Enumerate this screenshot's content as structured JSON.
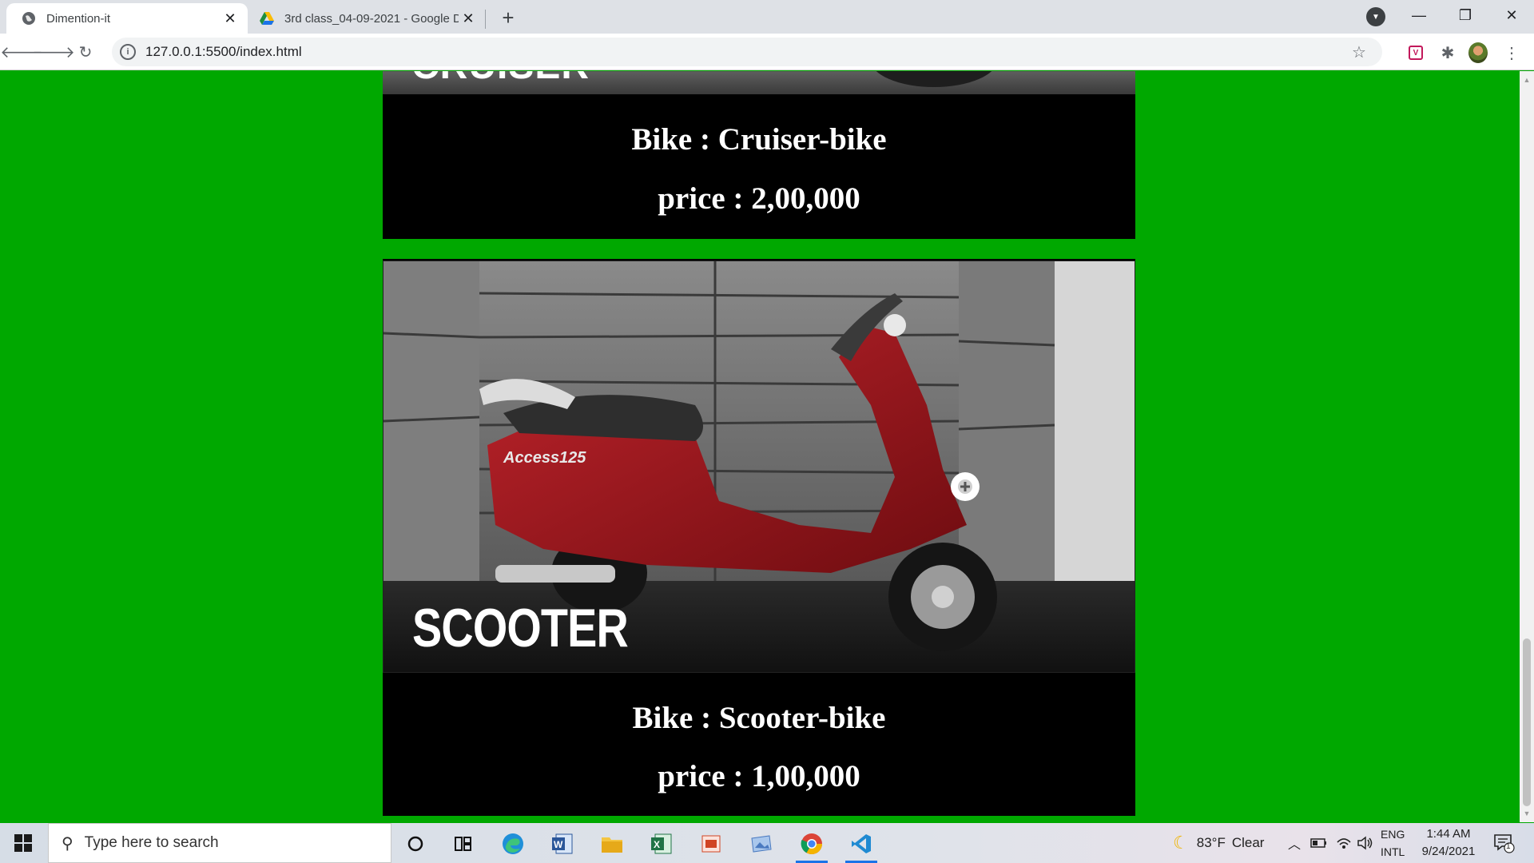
{
  "browser": {
    "tabs": [
      {
        "title": "Dimention-it",
        "active": true,
        "icon": "globe-icon"
      },
      {
        "title": "3rd class_04-09-2021 - Google D",
        "active": false,
        "icon": "google-drive-icon"
      }
    ],
    "url": "127.0.0.1:5500/index.html"
  },
  "page": {
    "background": "#00a800",
    "cards": [
      {
        "image_caption": "CRUISER",
        "bike_label": "Bike : Cruiser-bike",
        "price_label": "price : 2,00,000"
      },
      {
        "image_caption": "SCOOTER",
        "bike_label": "Bike : Scooter-bike",
        "price_label": "price : 1,00,000",
        "model_badge": "Access125"
      }
    ]
  },
  "taskbar": {
    "search_placeholder": "Type here to search",
    "weather": {
      "temp": "83°F",
      "condition": "Clear"
    },
    "lang_top": "ENG",
    "lang_bottom": "INTL",
    "time": "1:44 AM",
    "date": "9/24/2021",
    "notification_count": "1"
  }
}
